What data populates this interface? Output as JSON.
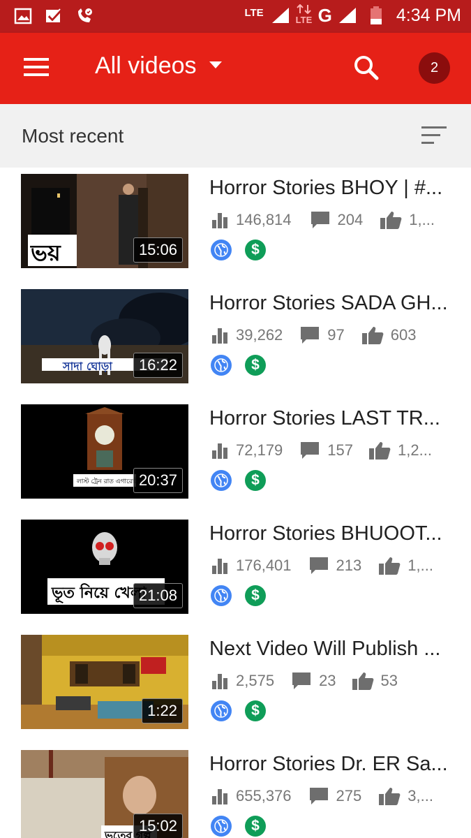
{
  "status_bar": {
    "network_1": "LTE",
    "network_2": "LTE",
    "network_type": "G",
    "time": "4:34 PM"
  },
  "app_bar": {
    "title": "All videos",
    "notification_count": "2"
  },
  "sort_bar": {
    "label": "Most recent"
  },
  "videos": [
    {
      "title": "Horror Stories  BHOY | #...",
      "duration": "15:06",
      "views": "146,814",
      "comments": "204",
      "likes": "1,...",
      "thumb_text": "ভয়"
    },
    {
      "title": "Horror Stories SADA GH...",
      "duration": "16:22",
      "views": "39,262",
      "comments": "97",
      "likes": "603",
      "thumb_text": "সাদা ঘোড়া"
    },
    {
      "title": "Horror Stories LAST TR...",
      "duration": "20:37",
      "views": "72,179",
      "comments": "157",
      "likes": "1,2...",
      "thumb_text": "লাস্ট ট্রেন রাত এগারোটা"
    },
    {
      "title": "Horror Stories BHUOOT...",
      "duration": "21:08",
      "views": "176,401",
      "comments": "213",
      "likes": "1,...",
      "thumb_text": "ভূত নিয়ে খেলা"
    },
    {
      "title": "Next Video Will Publish ...",
      "duration": "1:22",
      "views": "2,575",
      "comments": "23",
      "likes": "53"
    },
    {
      "title": "Horror Stories Dr. ER Sa...",
      "duration": "15:02",
      "views": "655,376",
      "comments": "275",
      "likes": "3,...",
      "thumb_text": "ভূতের গল্প"
    }
  ],
  "colors": {
    "status_bar": "#b71c1c",
    "app_bar": "#e62117",
    "sort_bar": "#f1f1f1",
    "public_badge": "#4285f4",
    "monetized_badge": "#0f9d58"
  },
  "icons": [
    "image-icon",
    "check-icon",
    "phone-icon",
    "signal-icon",
    "battery-icon",
    "menu-icon",
    "search-icon",
    "sort-icon",
    "views-icon",
    "comments-icon",
    "likes-icon",
    "globe-icon",
    "dollar-icon"
  ]
}
